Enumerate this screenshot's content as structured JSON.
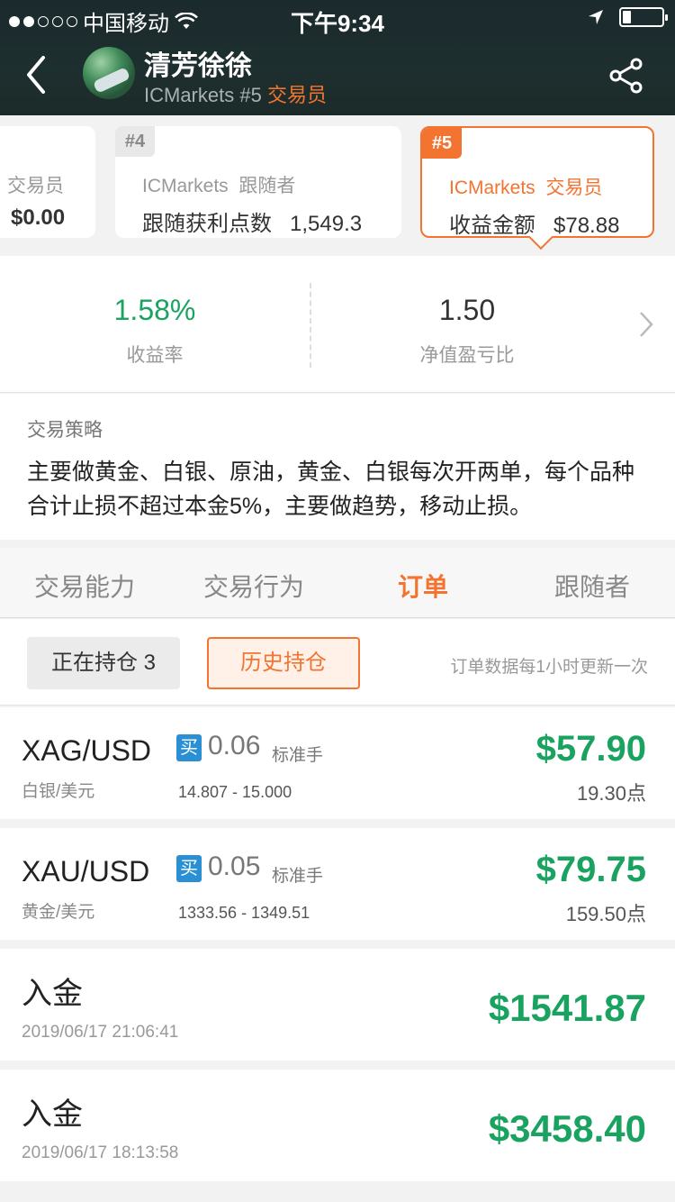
{
  "status_bar": {
    "carrier": "中国移动",
    "time": "下午9:34",
    "signal_filled": 2,
    "signal_total": 5,
    "battery_level": 0.22
  },
  "header": {
    "name": "清芳徐徐",
    "broker": "ICMarkets",
    "rank": "#5",
    "role": "交易员"
  },
  "cards": [
    {
      "rank": "",
      "line1": "交易员",
      "line2_label": "",
      "line2_value": "$0.00"
    },
    {
      "rank": "#4",
      "line1_a": "ICMarkets",
      "line1_b": "跟随者",
      "line2_label": "跟随获利点数",
      "line2_value": "1,549.3"
    },
    {
      "rank": "#5",
      "line1_a": "ICMarkets",
      "line1_b": "交易员",
      "line2_label": "收益金额",
      "line2_value": "$78.88"
    }
  ],
  "stats": {
    "return_rate": {
      "value": "1.58%",
      "label": "收益率"
    },
    "nav_ratio": {
      "value": "1.50",
      "label": "净值盈亏比"
    }
  },
  "strategy": {
    "title": "交易策略",
    "text": "主要做黄金、白银、原油，黄金、白银每次开两单，每个品种合计止损不超过本金5%，主要做趋势，移动止损。"
  },
  "tabs": [
    {
      "label": "交易能力",
      "active": false
    },
    {
      "label": "交易行为",
      "active": false
    },
    {
      "label": "订单",
      "active": true
    },
    {
      "label": "跟随者",
      "active": false
    }
  ],
  "filters": {
    "open_label": "正在持仓 3",
    "history_label": "历史持仓",
    "note": "订单数据每1小时更新一次"
  },
  "orders": [
    {
      "symbol": "XAG/USD",
      "name": "白银/美元",
      "side": "买",
      "lots": "0.06",
      "unit": "标准手",
      "range": "14.807 - 15.000",
      "profit": "$57.90",
      "points": "19.30点"
    },
    {
      "symbol": "XAU/USD",
      "name": "黄金/美元",
      "side": "买",
      "lots": "0.05",
      "unit": "标准手",
      "range": "1333.56 - 1349.51",
      "profit": "$79.75",
      "points": "159.50点"
    }
  ],
  "deposits": [
    {
      "title": "入金",
      "date": "2019/06/17 21:06:41",
      "amount": "$1541.87"
    },
    {
      "title": "入金",
      "date": "2019/06/17 18:13:58",
      "amount": "$3458.40"
    }
  ],
  "colors": {
    "accent": "#f27430",
    "profit": "#1aa360",
    "buy_badge": "#2b8fd4",
    "header_bg": "#1c2b2d"
  }
}
